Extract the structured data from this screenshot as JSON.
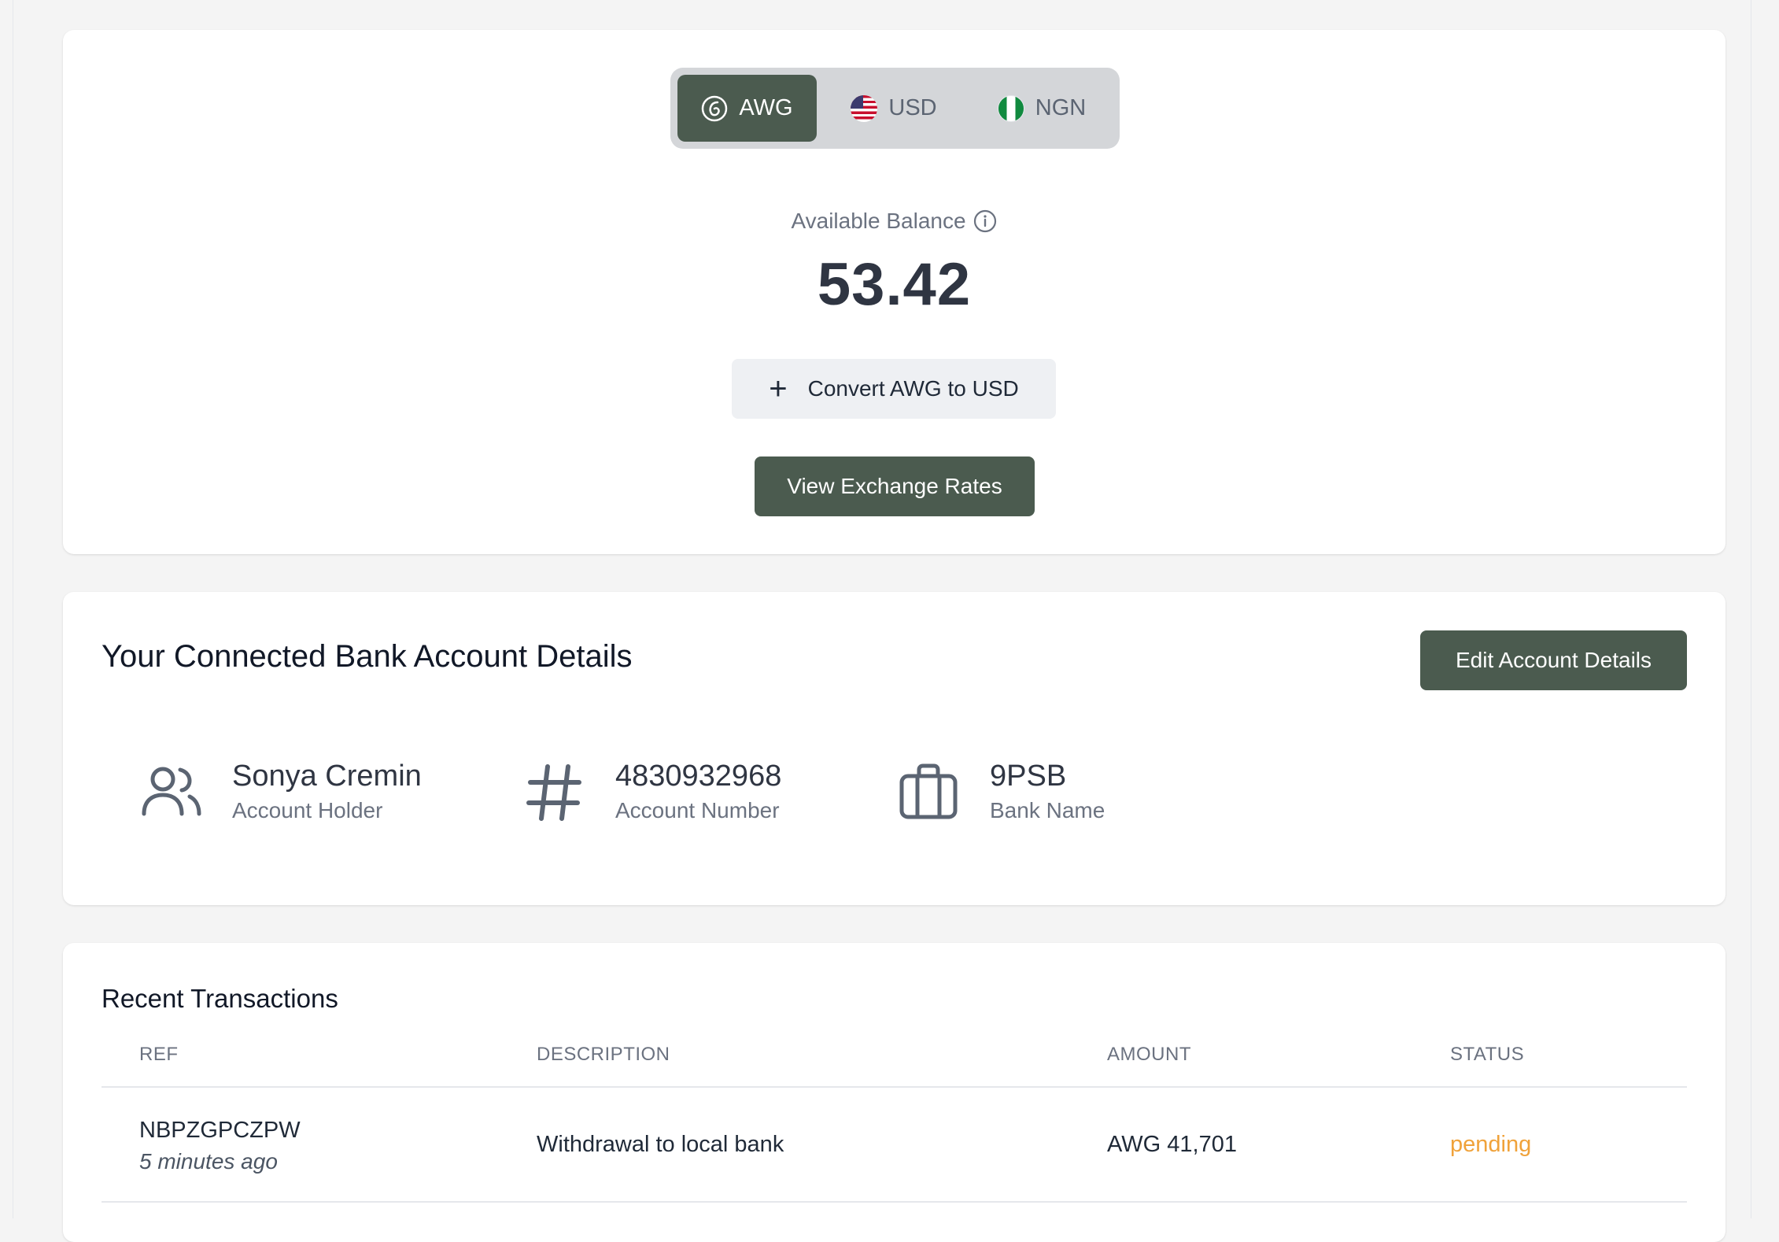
{
  "currency_tabs": [
    {
      "code": "AWG",
      "icon": "awg-coin-icon",
      "active": true
    },
    {
      "code": "USD",
      "icon": "us-flag-icon",
      "active": false
    },
    {
      "code": "NGN",
      "icon": "ng-flag-icon",
      "active": false
    }
  ],
  "balance": {
    "label": "Available Balance",
    "value": "53.42",
    "convert_label": "Convert AWG to USD",
    "rates_label": "View Exchange Rates"
  },
  "bank": {
    "title": "Your Connected Bank Account Details",
    "edit_label": "Edit Account Details",
    "holder_name": "Sonya Cremin",
    "holder_label": "Account Holder",
    "account_number": "4830932968",
    "account_number_label": "Account Number",
    "bank_name": "9PSB",
    "bank_name_label": "Bank Name"
  },
  "transactions": {
    "title": "Recent Transactions",
    "columns": [
      "REF",
      "DESCRIPTION",
      "AMOUNT",
      "STATUS"
    ],
    "rows": [
      {
        "ref": "NBPZGPCZPW",
        "time": "5 minutes ago",
        "description": "Withdrawal to local bank",
        "amount": "AWG 41,701",
        "status": "pending"
      }
    ]
  },
  "colors": {
    "accent": "#4b5b4f",
    "pending": "#f0a23a",
    "page_bg": "#f4f4f4"
  }
}
